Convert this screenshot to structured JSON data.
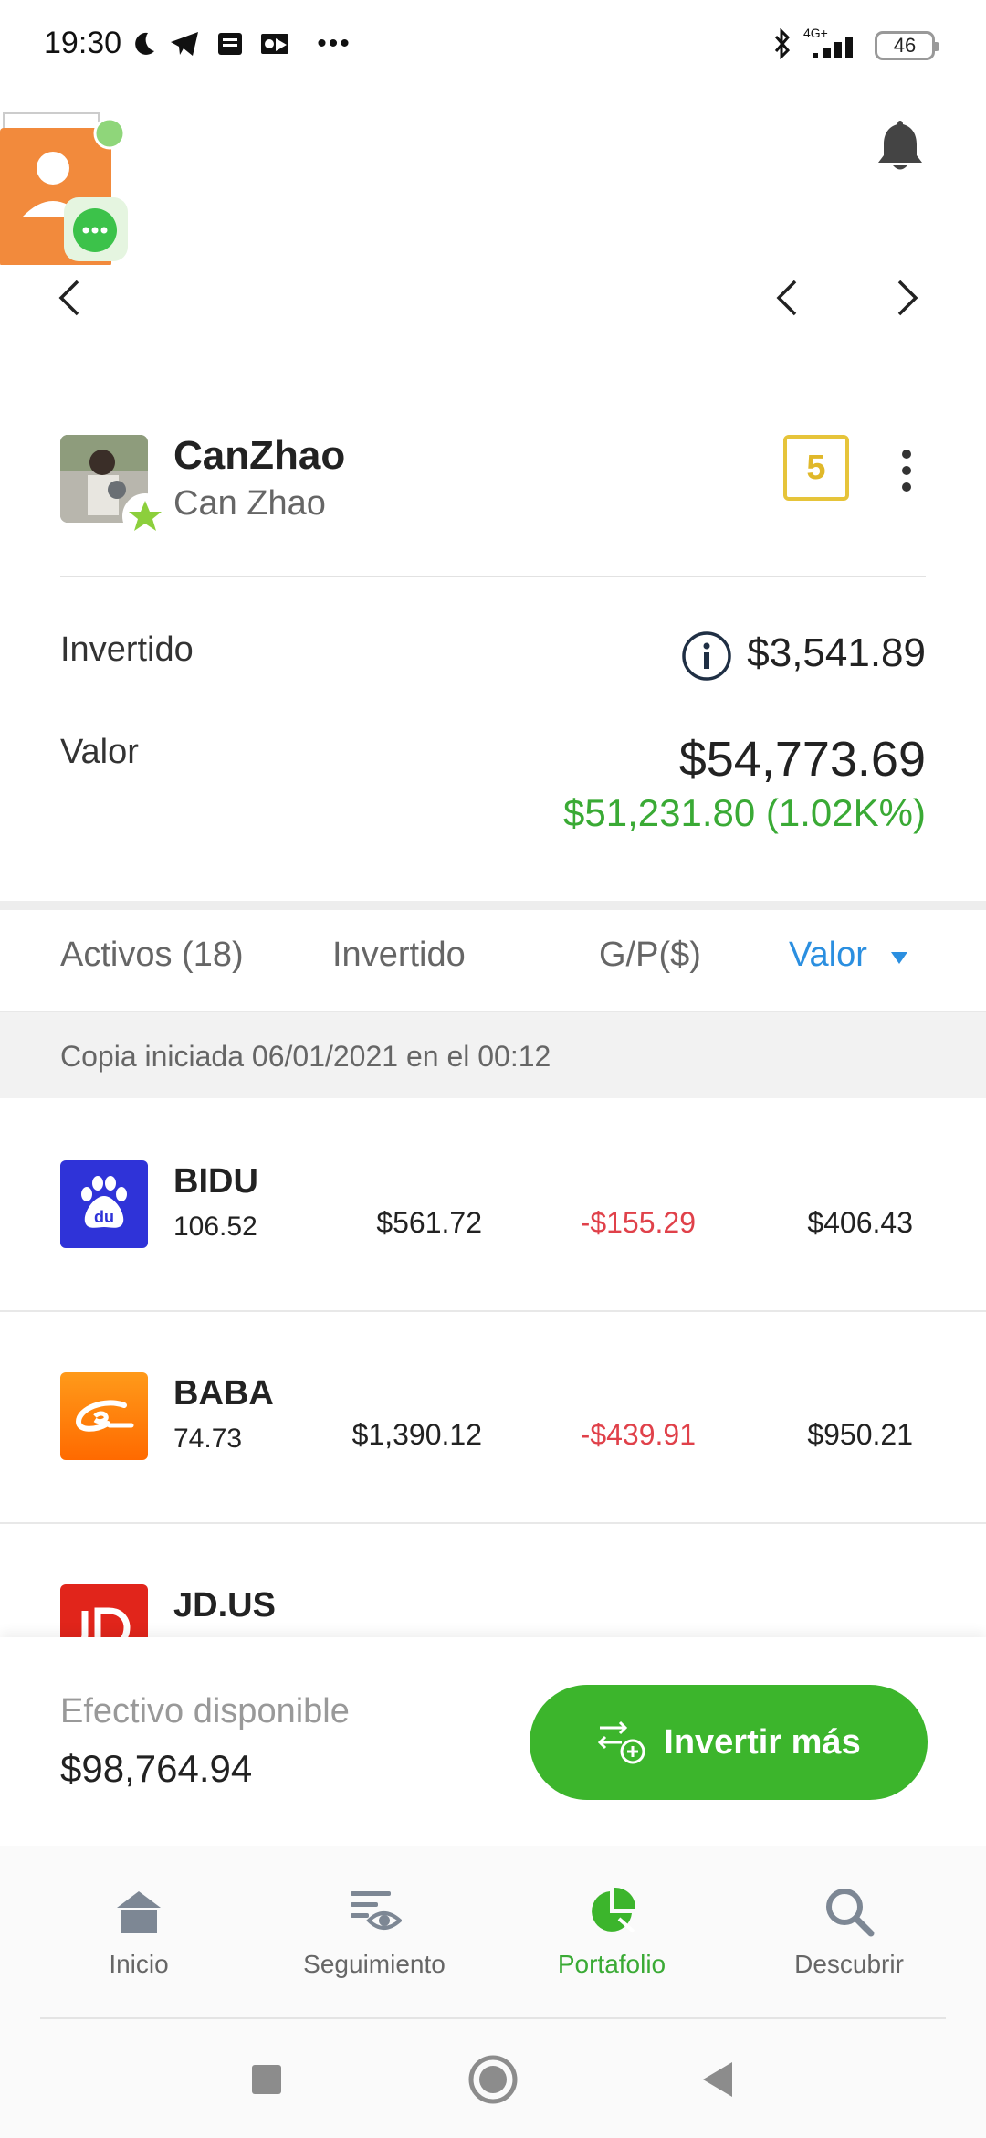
{
  "status_bar": {
    "time": "19:30",
    "network": "4G+",
    "battery": "46"
  },
  "profile": {
    "username": "CanZhao",
    "full_name": "Can Zhao",
    "level": "5"
  },
  "summary": {
    "invested_label": "Invertido",
    "invested_value": "$3,541.89",
    "value_label": "Valor",
    "value_total": "$54,773.69",
    "profit": "$51,231.80 (1.02K%)"
  },
  "table": {
    "headers": [
      "Activos (18)",
      "Invertido",
      "G/P($)",
      "Valor"
    ],
    "copy_note": "Copia iniciada 06/01/2021 en el 00:12",
    "rows": [
      {
        "ticker": "BIDU",
        "price": "106.52",
        "invested": "$561.72",
        "pl": "-$155.29",
        "value": "$406.43",
        "logo": "baidu-logo-icon",
        "logo_color": "#2f33d8"
      },
      {
        "ticker": "BABA",
        "price": "74.73",
        "invested": "$1,390.12",
        "pl": "-$439.91",
        "value": "$950.21",
        "logo": "alibaba-logo-icon",
        "logo_color": "#ff7300"
      },
      {
        "ticker": "JD.US",
        "price": "",
        "invested": "",
        "pl": "",
        "value": "",
        "logo": "jd-logo-icon",
        "logo_color": "#e1251b"
      }
    ]
  },
  "cash": {
    "label": "Efectivo disponible",
    "value": "$98,764.94",
    "invest_button": "Invertir más"
  },
  "bottom_nav": {
    "items": [
      {
        "label": "Inicio",
        "icon": "home-icon"
      },
      {
        "label": "Seguimiento",
        "icon": "watchlist-icon"
      },
      {
        "label": "Portafolio",
        "icon": "portfolio-pie-icon",
        "active": true
      },
      {
        "label": "Descubrir",
        "icon": "search-icon"
      }
    ]
  },
  "colors": {
    "green": "#3cb52c",
    "blue": "#2b8fe0",
    "red": "#e0414a",
    "gold": "#e6c43a"
  }
}
